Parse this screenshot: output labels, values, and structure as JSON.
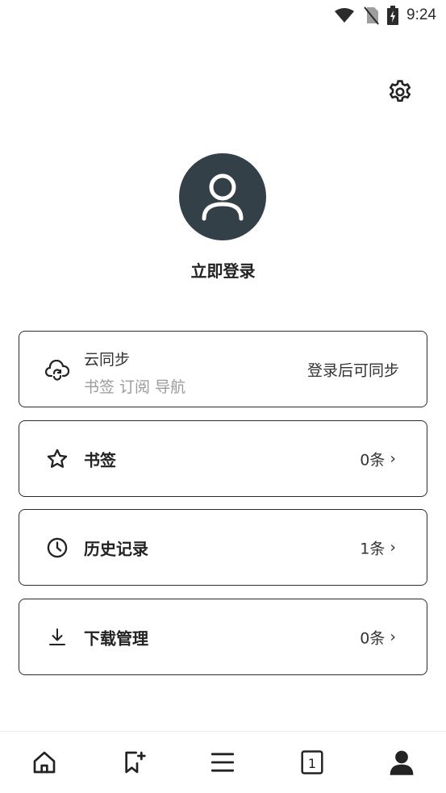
{
  "status_bar": {
    "time": "9:24",
    "icons": [
      "wifi-icon",
      "no-sim-icon",
      "battery-charging-icon"
    ]
  },
  "header": {
    "settings_icon": "gear-icon"
  },
  "profile": {
    "avatar_icon": "user-icon",
    "login_label": "立即登录"
  },
  "cards": {
    "sync": {
      "icon": "cloud-sync-icon",
      "title": "云同步",
      "subtitle": "书签 订阅 导航",
      "status": "登录后可同步"
    },
    "bookmarks": {
      "icon": "star-icon",
      "label": "书签",
      "count": "0条"
    },
    "history": {
      "icon": "clock-icon",
      "label": "历史记录",
      "count": "1条"
    },
    "downloads": {
      "icon": "download-icon",
      "label": "下载管理",
      "count": "0条"
    },
    "chevron": "›"
  },
  "bottom_nav": {
    "items": [
      "home-icon",
      "add-bookmark-icon",
      "menu-icon",
      "tabs-icon",
      "profile-icon"
    ],
    "tab_count": "1"
  },
  "colors": {
    "avatar_bg": "#334048",
    "text_primary": "#222222",
    "text_secondary": "#9a9a9a",
    "border": "#2a2a2a"
  }
}
